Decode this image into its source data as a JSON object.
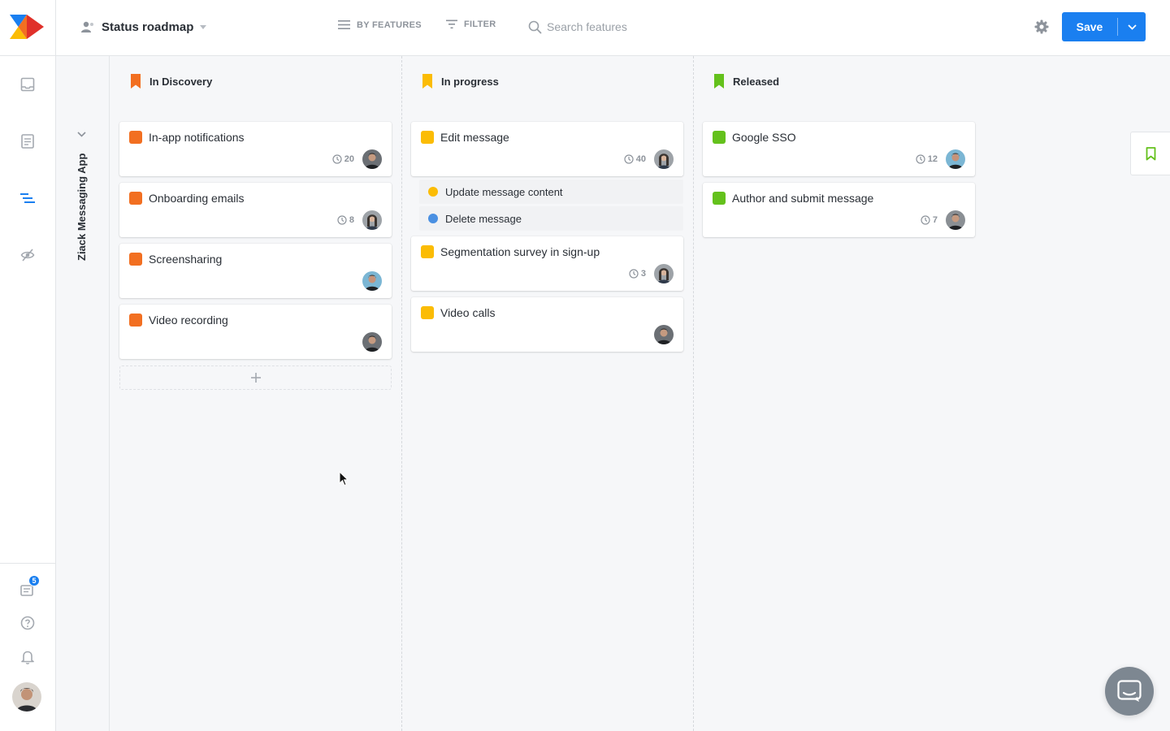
{
  "header": {
    "roadmap_title": "Status roadmap",
    "view_mode": "BY FEATURES",
    "filter": "FILTER",
    "search_placeholder": "Search features",
    "save_label": "Save"
  },
  "rail": {
    "notifications_badge": "5"
  },
  "group": {
    "name": "Ziack Messaging App"
  },
  "columns": [
    {
      "title": "In Discovery",
      "color": "#f26f21",
      "cards": [
        {
          "title": "In-app notifications",
          "effort": "20"
        },
        {
          "title": "Onboarding emails",
          "effort": "8"
        },
        {
          "title": "Screensharing",
          "effort": ""
        },
        {
          "title": "Video recording",
          "effort": ""
        }
      ]
    },
    {
      "title": "In progress",
      "color": "#fbbc05",
      "cards": [
        {
          "title": "Edit message",
          "effort": "40"
        },
        {
          "title": "Segmentation survey in sign-up",
          "effort": "3"
        },
        {
          "title": "Video calls",
          "effort": ""
        }
      ],
      "subfeatures": [
        {
          "title": "Update message content",
          "color": "#fbbc05"
        },
        {
          "title": "Delete message",
          "color": "#4a90e2"
        }
      ]
    },
    {
      "title": "Released",
      "color": "#64c11c",
      "cards": [
        {
          "title": "Google SSO",
          "effort": "12"
        },
        {
          "title": "Author and submit message",
          "effort": "7"
        }
      ]
    }
  ],
  "icons": {
    "roadmap": "roadmap-icon",
    "list": "list-icon",
    "filter": "filter-icon",
    "search": "search-icon",
    "settings": "gear-icon",
    "clock": "clock-icon",
    "bookmark": "bookmark-icon",
    "chat": "chat-icon"
  }
}
